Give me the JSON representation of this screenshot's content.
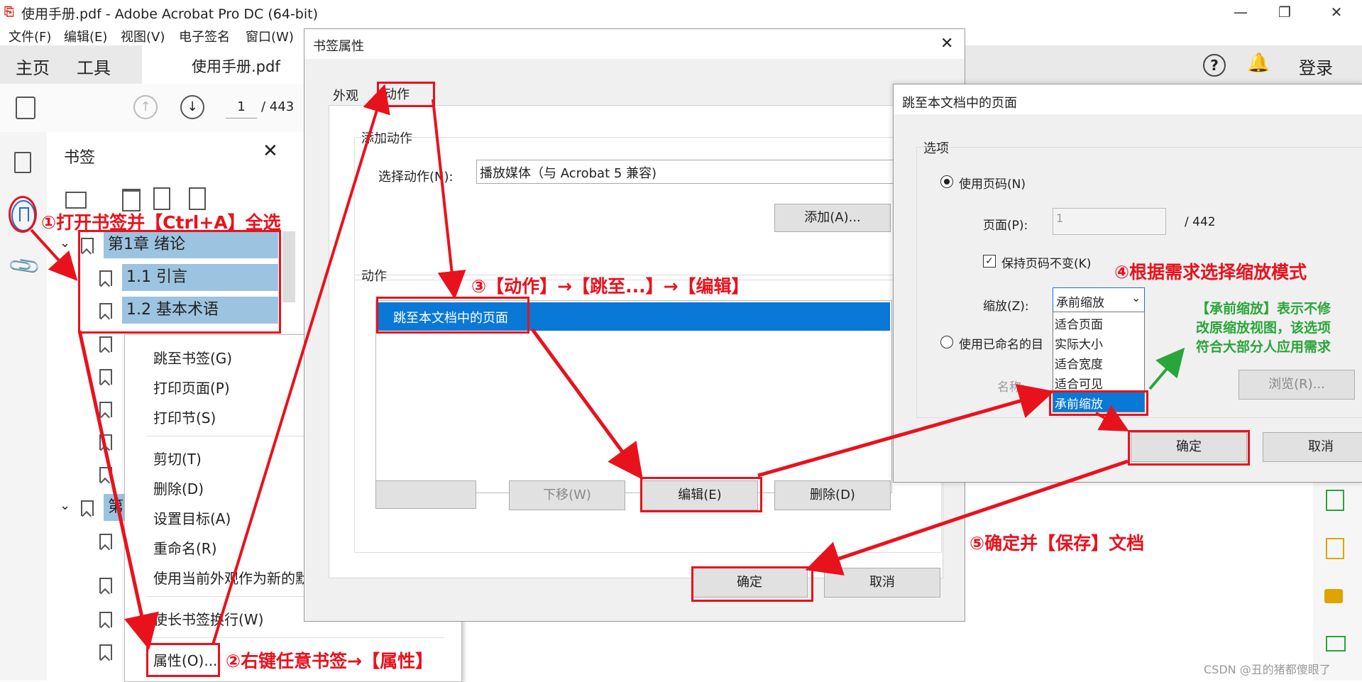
{
  "window": {
    "title": "使用手册.pdf - Adobe Acrobat Pro DC (64-bit)",
    "minimize": "—",
    "maximize": "❐",
    "close": "✕"
  },
  "menubar": [
    "文件(F)",
    "编辑(E)",
    "视图(V)",
    "电子签名",
    "窗口(W)"
  ],
  "toptabs": {
    "home": "主页",
    "tools": "工具",
    "document": "使用手册.pdf",
    "login": "登录"
  },
  "toolbar": {
    "page_current": "1",
    "page_total": "/ 443"
  },
  "bookmark_panel": {
    "title": "书签",
    "items": [
      "第1章 绪论",
      "1.1 引言",
      "1.2 基本术语",
      "第"
    ]
  },
  "context_menu": {
    "items": [
      "跳至书签(G)",
      "打印页面(P)",
      "打印节(S)",
      "剪切(T)",
      "删除(D)",
      "设置目标(A)",
      "重命名(R)",
      "使用当前外观作为新的默认外观(U)",
      "使长书签换行(W)",
      "属性(O)..."
    ]
  },
  "properties_dialog": {
    "title": "书签属性",
    "tabs": [
      "外观",
      "动作"
    ],
    "add_action_group": "添加动作",
    "select_action_label": "选择动作(N):",
    "select_action_value": "播放媒体（与 Acrobat 5 兼容)",
    "add_button": "添加(A)...",
    "actions_group": "动作",
    "action_items": [
      "跳至本文档中的页面"
    ],
    "buttons": {
      "down": "下移(W)",
      "edit": "编辑(E)",
      "delete": "删除(D)",
      "ok": "确定",
      "cancel": "取消"
    }
  },
  "jump_dialog": {
    "title": "跳至本文档中的页面",
    "options_group": "选项",
    "use_page_number": "使用页码(N)",
    "page_label": "页面(P):",
    "page_value": "1",
    "page_total": "/ 442",
    "keep_page_number": "保持页码不变(K)",
    "zoom_label": "缩放(Z):",
    "zoom_value": "承前缩放",
    "zoom_options": [
      "适合页面",
      "实际大小",
      "适合宽度",
      "适合可见",
      "承前缩放"
    ],
    "use_named_dest": "使用已命名的目",
    "name_label": "名称:",
    "browse_button": "浏览(R)...",
    "ok": "确定",
    "cancel": "取消"
  },
  "annotations": {
    "step1": "①打开书签并【Ctrl+A】全选",
    "step2": "②右键任意书签→【属性】",
    "step3": "③【动作】→【跳至...】→【编辑】",
    "step4": "④根据需求选择缩放模式",
    "step5": "⑤确定并【保存】文档",
    "note_lines": [
      "【承前缩放】表示不修",
      "改原缩放视图，该选项",
      "符合大部分人应用需求"
    ]
  },
  "watermark": "CSDN @丑的猪都傻眼了",
  "colors": {
    "annotation_red": "#e8121d",
    "annotation_green": "#2aa53a",
    "selection_blue": "#0a78d7",
    "bookmark_highlight": "#9cc3e0"
  }
}
